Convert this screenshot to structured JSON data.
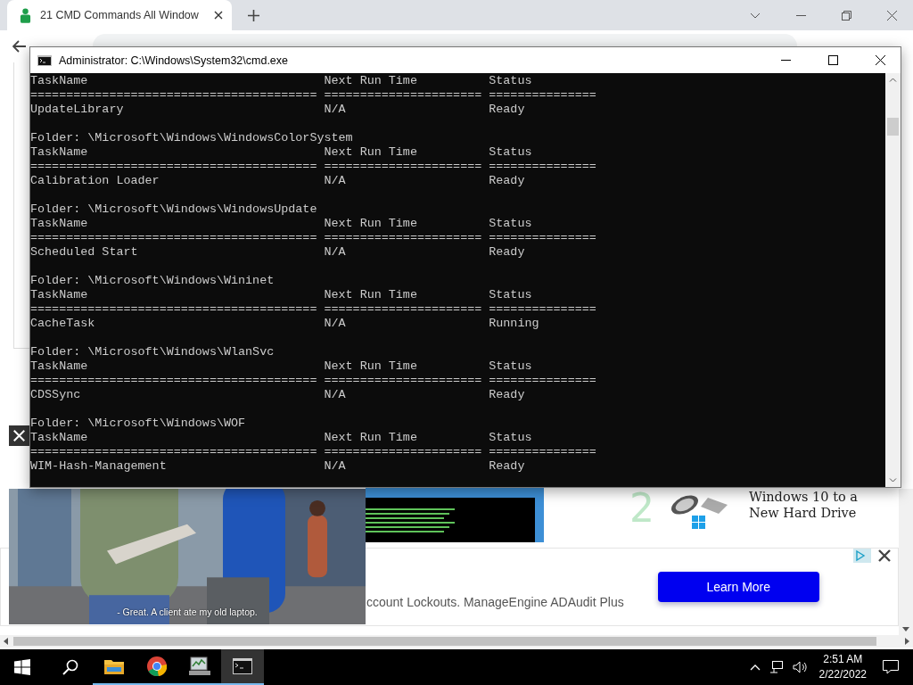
{
  "browser": {
    "tab": {
      "title": "21 CMD Commands All Window",
      "selected": true
    }
  },
  "page": {
    "related": {
      "number": "2",
      "title": "Windows 10 to a New Hard Drive"
    },
    "ad": {
      "text": "ccount Lockouts. ManageEngine ADAudit Plus",
      "button": "Learn More"
    },
    "video": {
      "caption": "- Great. A client ate my old laptop."
    }
  },
  "console": {
    "title": "Administrator: C:\\Windows\\System32\\cmd.exe",
    "lines": [
      {
        "kind": "header",
        "cells": [
          "TaskName",
          "Next Run Time",
          "Status"
        ]
      },
      {
        "kind": "rule",
        "cells": [
          "========================================",
          "======================",
          "==============="
        ]
      },
      {
        "kind": "row",
        "cells": [
          "UpdateLibrary",
          "N/A",
          "Ready"
        ]
      },
      {
        "kind": "blank"
      },
      {
        "kind": "folder",
        "text": "Folder: \\Microsoft\\Windows\\WindowsColorSystem"
      },
      {
        "kind": "header",
        "cells": [
          "TaskName",
          "Next Run Time",
          "Status"
        ]
      },
      {
        "kind": "rule",
        "cells": [
          "========================================",
          "======================",
          "==============="
        ]
      },
      {
        "kind": "row",
        "cells": [
          "Calibration Loader",
          "N/A",
          "Ready"
        ]
      },
      {
        "kind": "blank"
      },
      {
        "kind": "folder",
        "text": "Folder: \\Microsoft\\Windows\\WindowsUpdate"
      },
      {
        "kind": "header",
        "cells": [
          "TaskName",
          "Next Run Time",
          "Status"
        ]
      },
      {
        "kind": "rule",
        "cells": [
          "========================================",
          "======================",
          "==============="
        ]
      },
      {
        "kind": "row",
        "cells": [
          "Scheduled Start",
          "N/A",
          "Ready"
        ]
      },
      {
        "kind": "blank"
      },
      {
        "kind": "folder",
        "text": "Folder: \\Microsoft\\Windows\\Wininet"
      },
      {
        "kind": "header",
        "cells": [
          "TaskName",
          "Next Run Time",
          "Status"
        ]
      },
      {
        "kind": "rule",
        "cells": [
          "========================================",
          "======================",
          "==============="
        ]
      },
      {
        "kind": "row",
        "cells": [
          "CacheTask",
          "N/A",
          "Running"
        ]
      },
      {
        "kind": "blank"
      },
      {
        "kind": "folder",
        "text": "Folder: \\Microsoft\\Windows\\WlanSvc"
      },
      {
        "kind": "header",
        "cells": [
          "TaskName",
          "Next Run Time",
          "Status"
        ]
      },
      {
        "kind": "rule",
        "cells": [
          "========================================",
          "======================",
          "==============="
        ]
      },
      {
        "kind": "row",
        "cells": [
          "CDSSync",
          "N/A",
          "Ready"
        ]
      },
      {
        "kind": "blank"
      },
      {
        "kind": "folder",
        "text": "Folder: \\Microsoft\\Windows\\WOF"
      },
      {
        "kind": "header",
        "cells": [
          "TaskName",
          "Next Run Time",
          "Status"
        ]
      },
      {
        "kind": "rule",
        "cells": [
          "========================================",
          "======================",
          "==============="
        ]
      },
      {
        "kind": "row",
        "cells": [
          "WIM-Hash-Management",
          "N/A",
          "Ready"
        ]
      }
    ]
  },
  "taskbar": {
    "apps": [
      {
        "kind": "folder",
        "open": true,
        "selected": false
      },
      {
        "kind": "chrome",
        "open": true,
        "selected": false
      },
      {
        "kind": "monitor",
        "open": true,
        "selected": false
      },
      {
        "kind": "console",
        "open": true,
        "selected": true
      }
    ],
    "time": "2:51 AM",
    "date": "2/22/2022"
  }
}
